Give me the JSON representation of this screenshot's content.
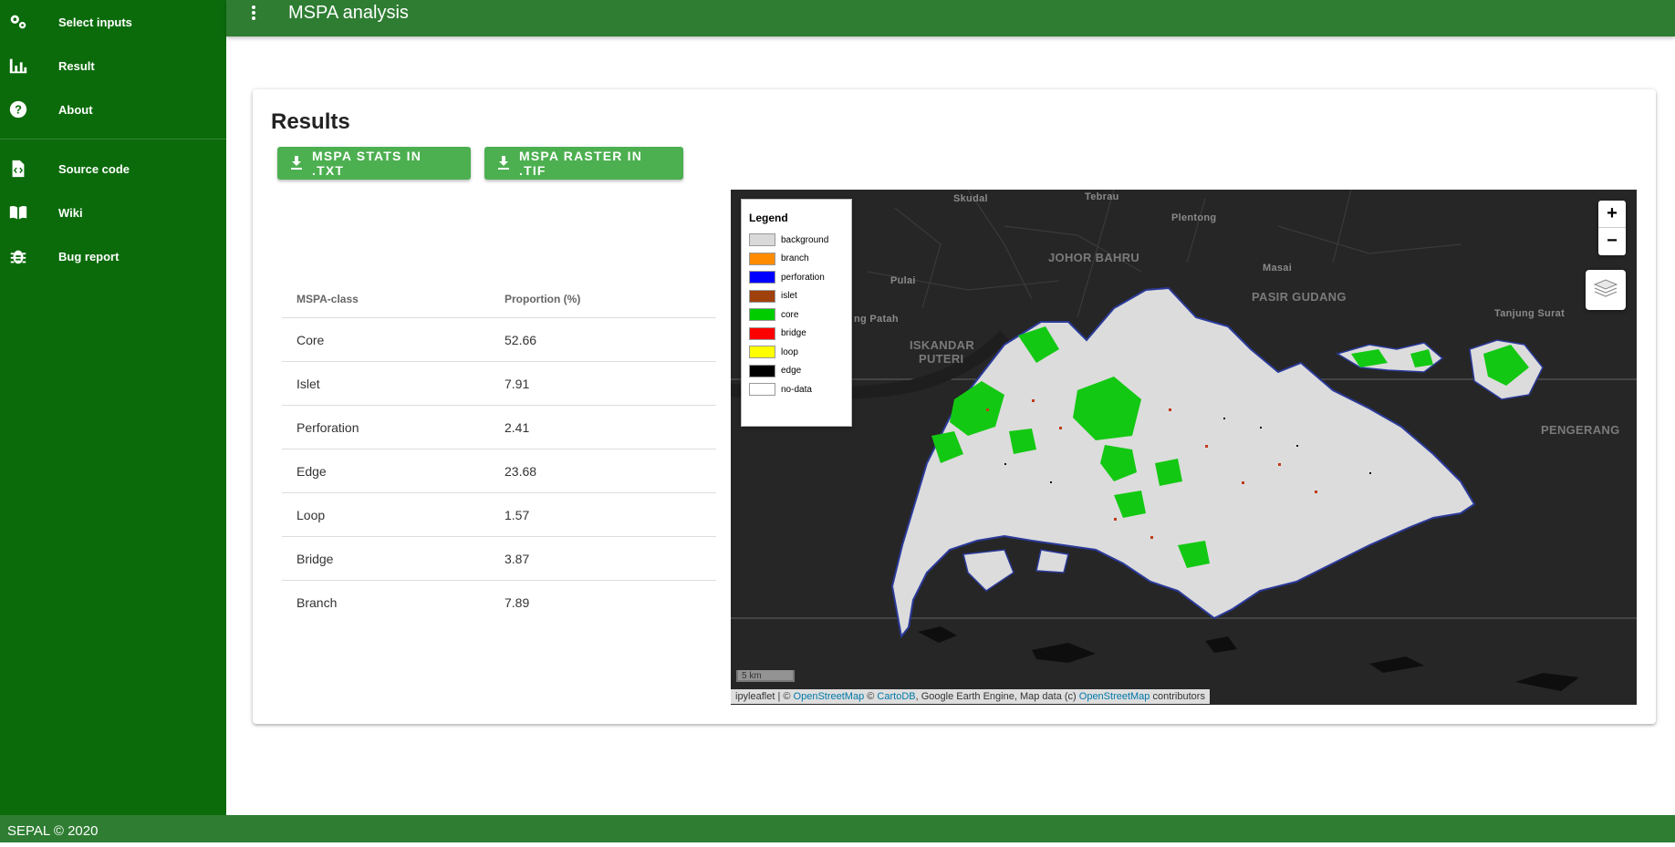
{
  "sidebar": {
    "items": [
      {
        "label": "Select inputs",
        "icon": "gears-icon"
      },
      {
        "label": "Result",
        "icon": "bar-chart-icon"
      },
      {
        "label": "About",
        "icon": "help-circle-icon"
      },
      {
        "label": "Source code",
        "icon": "file-code-icon"
      },
      {
        "label": "Wiki",
        "icon": "book-open-icon"
      },
      {
        "label": "Bug report",
        "icon": "bug-icon"
      }
    ]
  },
  "appbar": {
    "title": "MSPA analysis",
    "menu_icon": "dots-vertical-icon"
  },
  "footer": {
    "text": "SEPAL © 2020"
  },
  "results": {
    "title": "Results",
    "buttons": {
      "stats": "MSPA STATS IN .TXT",
      "raster": "MSPA RASTER IN .TIF"
    },
    "table": {
      "headers": [
        "MSPA-class",
        "Proportion (%)"
      ],
      "rows": [
        {
          "cls": "Core",
          "val": "52.66"
        },
        {
          "cls": "Islet",
          "val": "7.91"
        },
        {
          "cls": "Perforation",
          "val": "2.41"
        },
        {
          "cls": "Edge",
          "val": "23.68"
        },
        {
          "cls": "Loop",
          "val": "1.57"
        },
        {
          "cls": "Bridge",
          "val": "3.87"
        },
        {
          "cls": "Branch",
          "val": "7.89"
        }
      ]
    }
  },
  "map": {
    "legend": {
      "title": "Legend",
      "items": [
        {
          "label": "background",
          "color": "#d9d9d9"
        },
        {
          "label": "branch",
          "color": "#ff8c00"
        },
        {
          "label": "perforation",
          "color": "#0000ff"
        },
        {
          "label": "islet",
          "color": "#a0410d"
        },
        {
          "label": "core",
          "color": "#00cc00"
        },
        {
          "label": "bridge",
          "color": "#ff0000"
        },
        {
          "label": "loop",
          "color": "#ffff00"
        },
        {
          "label": "edge",
          "color": "#000000"
        },
        {
          "label": "no-data",
          "color": "#ffffff"
        }
      ]
    },
    "zoom_in": "+",
    "zoom_out": "−",
    "scale": "5 km",
    "places": {
      "skudai": "Skudal",
      "tebrau": "Tebrau",
      "plentong": "Plentong",
      "johor_bahru": "JOHOR BAHRU",
      "masai": "Masai",
      "pasir_gudang": "PASIR GUDANG",
      "pulai": "Pulai",
      "gelang_patah": "ng Patah",
      "iskandar": "ISKANDAR",
      "puteri": "PUTERI",
      "tanjung_surat": "Tanjung Surat",
      "pengerang": "PENGERANG"
    },
    "attribution": {
      "prefix": "ipyleaflet | © ",
      "osm1": "OpenStreetMap",
      "mid1": " © ",
      "carto": "CartoDB",
      "mid2": ", Google Earth Engine, Map data (c) ",
      "osm2": "OpenStreetMap",
      "suffix": " contributors"
    }
  }
}
